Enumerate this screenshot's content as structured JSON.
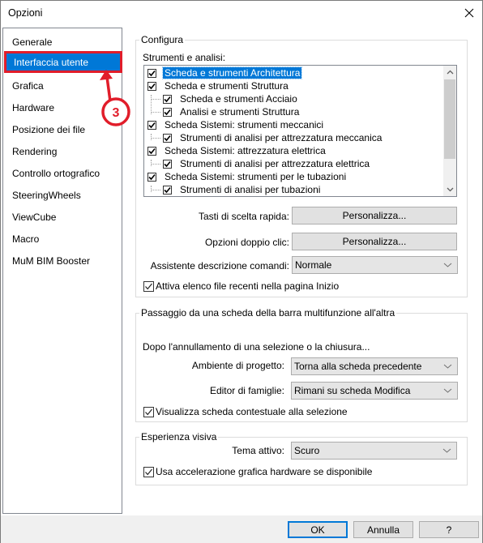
{
  "window": {
    "title": "Opzioni",
    "close_icon": "close-icon"
  },
  "sidebar": {
    "selected_index": 1,
    "items": [
      {
        "label": "Generale"
      },
      {
        "label": "Interfaccia utente"
      },
      {
        "label": "Grafica"
      },
      {
        "label": "Hardware"
      },
      {
        "label": "Posizione dei file"
      },
      {
        "label": "Rendering"
      },
      {
        "label": "Controllo ortografico"
      },
      {
        "label": "SteeringWheels"
      },
      {
        "label": "ViewCube"
      },
      {
        "label": "Macro"
      },
      {
        "label": "MuM BIM Booster"
      }
    ]
  },
  "annotation": {
    "step_number": "3",
    "color": "#e11d2a"
  },
  "configura": {
    "legend": "Configura",
    "tools_label": "Strumenti e analisi:",
    "tree": [
      {
        "label": "Scheda e strumenti Architettura",
        "checked": true,
        "level": 0,
        "selected": true
      },
      {
        "label": "Scheda e strumenti Struttura",
        "checked": true,
        "level": 0,
        "selected": false
      },
      {
        "label": "Scheda e strumenti Acciaio",
        "checked": true,
        "level": 1,
        "selected": false
      },
      {
        "label": "Analisi e strumenti Struttura",
        "checked": true,
        "level": 1,
        "selected": false
      },
      {
        "label": "Scheda Sistemi: strumenti meccanici",
        "checked": true,
        "level": 0,
        "selected": false
      },
      {
        "label": "Strumenti di analisi per attrezzatura meccanica",
        "checked": true,
        "level": 1,
        "selected": false
      },
      {
        "label": "Scheda Sistemi: attrezzatura elettrica",
        "checked": true,
        "level": 0,
        "selected": false
      },
      {
        "label": "Strumenti di analisi per attrezzatura elettrica",
        "checked": true,
        "level": 1,
        "selected": false
      },
      {
        "label": "Scheda Sistemi: strumenti per le tubazioni",
        "checked": true,
        "level": 0,
        "selected": false
      },
      {
        "label": "Strumenti di analisi per tubazioni",
        "checked": true,
        "level": 1,
        "selected": false
      }
    ],
    "shortcuts_label": "Tasti di scelta rapida:",
    "shortcuts_button": "Personalizza...",
    "doubleclick_label": "Opzioni doppio clic:",
    "doubleclick_button": "Personalizza...",
    "tooltip_label": "Assistente descrizione comandi:",
    "tooltip_value": "Normale",
    "recent_files_label": "Attiva elenco file recenti nella pagina Inizio",
    "recent_files_checked": true
  },
  "ribbon": {
    "legend": "Passaggio da una scheda della barra multifunzione all'altra",
    "after_label": "Dopo l'annullamento di una selezione o la chiusura...",
    "project_label": "Ambiente di progetto:",
    "project_value": "Torna alla scheda precedente",
    "family_label": "Editor di famiglie:",
    "family_value": "Rimani su scheda Modifica",
    "contextual_label": "Visualizza scheda contestuale alla selezione",
    "contextual_checked": true
  },
  "visual": {
    "legend": "Esperienza visiva",
    "theme_label": "Tema attivo:",
    "theme_value": "Scuro",
    "hw_accel_label": "Usa accelerazione grafica hardware se disponibile",
    "hw_accel_checked": true
  },
  "footer": {
    "ok": "OK",
    "cancel": "Annulla",
    "help": "?"
  },
  "colors": {
    "accent": "#0078d7",
    "annotation": "#e11d2a"
  }
}
